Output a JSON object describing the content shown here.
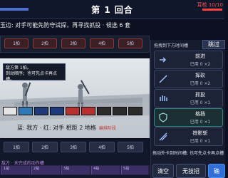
{
  "header": {
    "round_title": "第 1 回合",
    "hp_label": "耳枪 10/10",
    "hp_fraction": 1.0
  },
  "hint_text": "玉边: 对手可能先防守试探，再寻找抓投 · 候选 6 套",
  "enemy_slots": [
    "1拍",
    "2拍",
    "3拍",
    "4拍",
    "5拍"
  ],
  "tooltip": {
    "line1": "敌方第 1拍。",
    "line2": "到动顺序；也可先点卡再点槽。"
  },
  "grid_info": {
    "text": "蓝: 我方 · 红: 对手  相距 2 地格",
    "tag": "编排阶段"
  },
  "panel": {
    "header": "拖拽到下方时间槽",
    "skip_label": "跳过",
    "cards": [
      {
        "name": "前进",
        "count": "已用 0 ×2",
        "icon": "dash-icon"
      },
      {
        "name": "挥砍",
        "count": "已用 0 ×2",
        "icon": "slash-icon"
      },
      {
        "name": "抓投",
        "count": "已用 0 ×1",
        "icon": "grab-icon"
      },
      {
        "name": "格挡",
        "count": "已用 0 ×1",
        "icon": "shield-icon"
      },
      {
        "name": "掠影斩",
        "count": "已用 0 ×1",
        "icon": "shadow-slash-icon"
      }
    ],
    "drag_hint": "拖动外卡到时间槽; 也可先点卡再点槽",
    "clear_label": "清空",
    "no_attack_label": "无技招",
    "confirm_label": "确"
  },
  "player_slots": [
    "1拍",
    "2拍",
    "3拍",
    "4拍",
    "5拍"
  ],
  "enemy_queue_label": "敌方 · 未完成的动作槽",
  "enemy_queue": [
    "1拍",
    "2拍",
    "3拍",
    "4拍",
    "5拍"
  ]
}
